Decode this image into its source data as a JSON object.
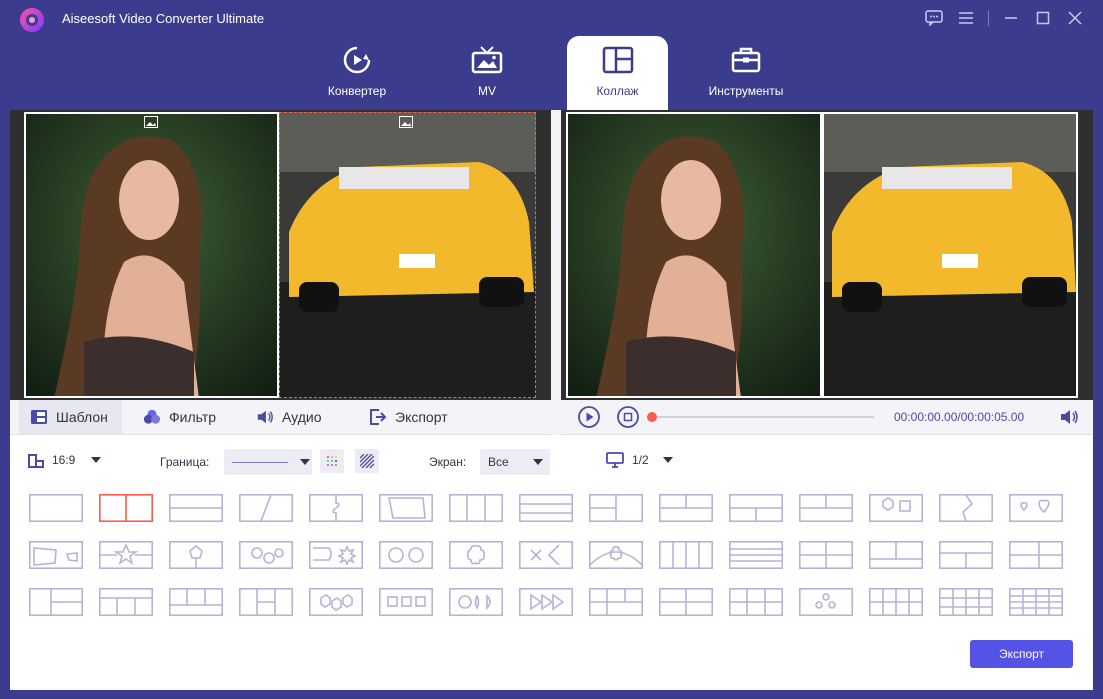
{
  "app": {
    "title": "Aiseesoft Video Converter Ultimate"
  },
  "nav": {
    "tabs": [
      {
        "label": "Конвертер",
        "icon": "converter-icon"
      },
      {
        "label": "MV",
        "icon": "mv-tv-icon"
      },
      {
        "label": "Коллаж",
        "icon": "collage-icon",
        "active": true
      },
      {
        "label": "Инструменты",
        "icon": "toolbox-icon"
      }
    ]
  },
  "tool_tabs": {
    "template": "Шаблон",
    "filter": "Фильтр",
    "audio": "Аудио",
    "export": "Экспорт"
  },
  "player": {
    "time": "00:00:00.00/00:00:05.00",
    "progress": 0
  },
  "options": {
    "ratio": "16:9",
    "border_label": "Граница:",
    "screen_label": "Экран:",
    "screen_value": "Все",
    "page_value": "1/2"
  },
  "export_button": "Экспорт",
  "colors": {
    "accent": "#5552e6",
    "header_bg": "#3c3c8e",
    "selected_template": "#ff5a4a",
    "template_stroke": "#b4b4d8"
  }
}
